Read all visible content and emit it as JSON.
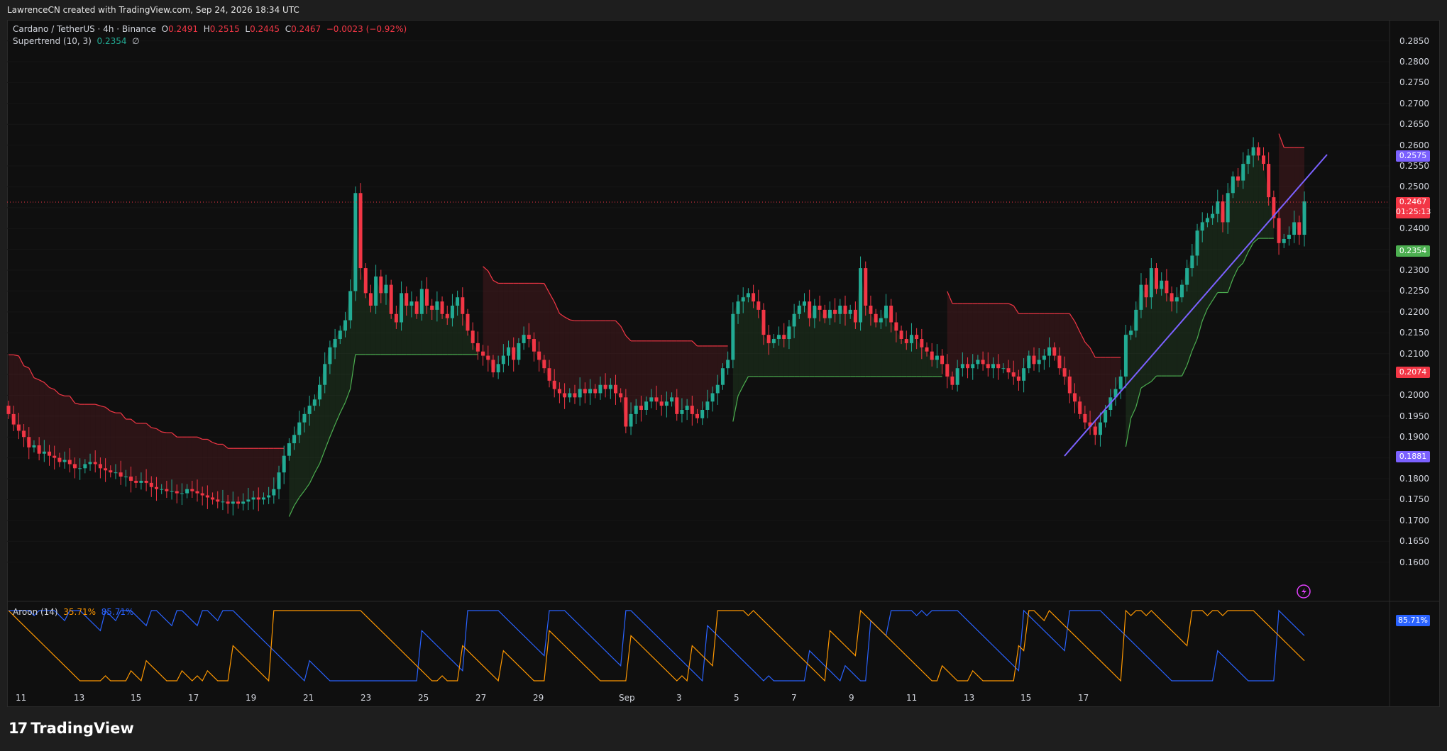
{
  "header": {
    "attribution": "LawrenceCN created with TradingView.com, Sep 24, 2026 18:34 UTC"
  },
  "legend": {
    "symbol": "Cardano / TetherUS · 4h · Binance",
    "o_label": "O",
    "o_value": "0.2491",
    "h_label": "H",
    "h_value": "0.2515",
    "l_label": "L",
    "l_value": "0.2445",
    "c_label": "C",
    "c_value": "0.2467",
    "change": "−0.0023 (−0.92%)",
    "supertrend_name": "Supertrend (10, 3)",
    "supertrend_value": "0.2354",
    "supertrend_extra": "∅",
    "aroon_name": "Aroon (14)",
    "aroon_up": "35.71%",
    "aroon_down": "85.71%"
  },
  "price_labels": {
    "top_line": "0.2575",
    "last_price": "0.2467",
    "countdown": "01:25:13",
    "supertrend": "0.2354",
    "red_level": "0.2074",
    "bottom_line": "0.1881",
    "aroon_value": "85.71%"
  },
  "brand": {
    "name": "TradingView",
    "mark": "17"
  },
  "colors": {
    "up": "#22ab94",
    "down": "#f23645",
    "supertrend_up": "#4caf50",
    "supertrend_down": "#f23645",
    "trendline": "#7b61ff",
    "aroon_up": "#ff9800",
    "aroon_down": "#2962ff"
  },
  "chart_data": {
    "type": "candlestick",
    "symbol": "ADA/USDT",
    "timeframe": "4h",
    "ylim": [
      0.155,
      0.288
    ],
    "y_ticks": [
      "0.2850",
      "0.2800",
      "0.2750",
      "0.2700",
      "0.2650",
      "0.2600",
      "0.2550",
      "0.2500",
      "0.2450",
      "0.2400",
      "0.2350",
      "0.2300",
      "0.2250",
      "0.2200",
      "0.2150",
      "0.2100",
      "0.2050",
      "0.2000",
      "0.1950",
      "0.1900",
      "0.1850",
      "0.1800",
      "0.1750",
      "0.1700",
      "0.1650",
      "0.1600"
    ],
    "x_ticks": [
      "11",
      "13",
      "15",
      "17",
      "19",
      "21",
      "23",
      "25",
      "27",
      "29",
      "Sep",
      "3",
      "5",
      "7",
      "9",
      "11",
      "13",
      "15",
      "17"
    ],
    "closes": [
      0.1955,
      0.193,
      0.1915,
      0.19,
      0.1875,
      0.188,
      0.186,
      0.1865,
      0.1855,
      0.185,
      0.184,
      0.1845,
      0.1835,
      0.1825,
      0.1825,
      0.1835,
      0.184,
      0.1835,
      0.1825,
      0.182,
      0.1815,
      0.1815,
      0.1805,
      0.1805,
      0.1795,
      0.179,
      0.1795,
      0.179,
      0.178,
      0.1775,
      0.1775,
      0.177,
      0.177,
      0.1765,
      0.1765,
      0.1775,
      0.177,
      0.1765,
      0.176,
      0.1755,
      0.175,
      0.1745,
      0.1745,
      0.174,
      0.1745,
      0.174,
      0.1745,
      0.175,
      0.1755,
      0.175,
      0.1755,
      0.176,
      0.1775,
      0.1815,
      0.1855,
      0.1885,
      0.1905,
      0.1935,
      0.1955,
      0.1975,
      0.199,
      0.2025,
      0.2075,
      0.2115,
      0.2135,
      0.2155,
      0.218,
      0.225,
      0.2485,
      0.2305,
      0.2245,
      0.2215,
      0.2285,
      0.2245,
      0.2265,
      0.2195,
      0.2175,
      0.2245,
      0.2215,
      0.2225,
      0.2195,
      0.2255,
      0.2215,
      0.2205,
      0.2225,
      0.2195,
      0.2185,
      0.2215,
      0.2235,
      0.2195,
      0.2155,
      0.2125,
      0.2105,
      0.2095,
      0.2085,
      0.2055,
      0.2075,
      0.2095,
      0.2115,
      0.2085,
      0.2125,
      0.2145,
      0.2135,
      0.2105,
      0.2085,
      0.2065,
      0.2035,
      0.2015,
      0.2005,
      0.1995,
      0.2005,
      0.1995,
      0.2015,
      0.2005,
      0.2015,
      0.2005,
      0.2025,
      0.2015,
      0.2025,
      0.2005,
      0.1995,
      0.1925,
      0.1955,
      0.1975,
      0.1965,
      0.1985,
      0.1995,
      0.1985,
      0.1975,
      0.1985,
      0.1995,
      0.1955,
      0.1965,
      0.1975,
      0.1955,
      0.1945,
      0.1965,
      0.1985,
      0.2005,
      0.2025,
      0.2065,
      0.2085,
      0.2195,
      0.2225,
      0.2235,
      0.2245,
      0.2225,
      0.2205,
      0.2145,
      0.2125,
      0.2135,
      0.2145,
      0.2135,
      0.2165,
      0.2195,
      0.2215,
      0.2225,
      0.2185,
      0.2215,
      0.2205,
      0.2185,
      0.2205,
      0.2195,
      0.2215,
      0.2195,
      0.2205,
      0.2175,
      0.2305,
      0.2215,
      0.2195,
      0.2175,
      0.2185,
      0.2215,
      0.2175,
      0.2155,
      0.2135,
      0.2125,
      0.2145,
      0.2135,
      0.2115,
      0.2105,
      0.2085,
      0.2095,
      0.2075,
      0.2045,
      0.2025,
      0.2065,
      0.2075,
      0.2065,
      0.2075,
      0.2085,
      0.2075,
      0.2065,
      0.2075,
      0.2065,
      0.2065,
      0.2055,
      0.2045,
      0.2035,
      0.2065,
      0.2095,
      0.2075,
      0.2085,
      0.2095,
      0.2115,
      0.2095,
      0.2065,
      0.2045,
      0.2005,
      0.1985,
      0.1955,
      0.1935,
      0.1925,
      0.1905,
      0.1935,
      0.1965,
      0.1995,
      0.2015,
      0.2045,
      0.2145,
      0.2155,
      0.2205,
      0.2265,
      0.2235,
      0.2305,
      0.2255,
      0.2275,
      0.2245,
      0.2225,
      0.2235,
      0.2265,
      0.2305,
      0.2335,
      0.2395,
      0.2415,
      0.2425,
      0.2435,
      0.2465,
      0.2415,
      0.2485,
      0.2525,
      0.2515,
      0.2555,
      0.2575,
      0.2595,
      0.2575,
      0.2555,
      0.2475,
      0.2425,
      0.2365,
      0.2375,
      0.2385,
      0.2415,
      0.2385,
      0.2465
    ]
  }
}
